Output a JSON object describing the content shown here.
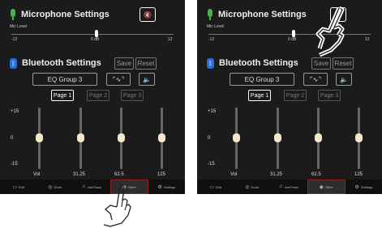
{
  "panels": [
    {
      "mic_title": "Microphone Settings",
      "mic_level_label": "Mic Level",
      "scale": [
        "-12",
        "0 dB",
        "12"
      ],
      "bt_title": "Bluetooth Settings",
      "save": "Save",
      "reset": "Reset",
      "eq_group": "EQ Group 3",
      "wave_glyph": "⌜∿⌝",
      "speaker_glyph": "🔈",
      "mute_glyph": "🔇",
      "pages": [
        "Page 1",
        "Page 2",
        "Page 3"
      ],
      "db_labels": [
        "+15",
        "0",
        "-15"
      ],
      "freqs": [
        "Vol",
        "31.25",
        "62.5",
        "125"
      ],
      "nav": [
        "Edit",
        "Drum",
        "JamTrack",
        "Other",
        "Settings"
      ]
    },
    {
      "mic_title": "Microphone Settings",
      "mic_level_label": "Mic Level",
      "scale": [
        "-12",
        "0 dB",
        "12"
      ],
      "bt_title": "Bluetooth Settings",
      "save": "Save",
      "reset": "Reset",
      "eq_group": "EQ Group 3",
      "wave_glyph": "⌜∿⌝",
      "speaker_glyph": "🔈",
      "mute_glyph": "🔇",
      "pages": [
        "Page 1",
        "Page 2",
        "Page 3"
      ],
      "db_labels": [
        "+15",
        "0",
        "-15"
      ],
      "freqs": [
        "Vol",
        "31.25",
        "62.5",
        "125"
      ],
      "nav": [
        "Edit",
        "Drum",
        "JamTrack",
        "Other",
        "Settings"
      ]
    }
  ],
  "active_page_index": 0,
  "active_nav_index": 3
}
